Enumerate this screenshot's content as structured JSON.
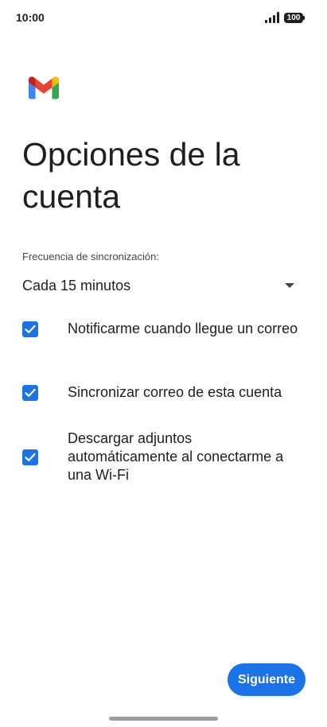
{
  "status_bar": {
    "time": "10:00",
    "battery": "100"
  },
  "page": {
    "title": "Opciones de la cuenta"
  },
  "sync": {
    "label": "Frecuencia de sincronización:",
    "selected": "Cada 15 minutos"
  },
  "options": [
    {
      "label": "Notificarme cuando llegue un correo",
      "checked": true
    },
    {
      "label": "Sincronizar correo de esta cuenta",
      "checked": true
    },
    {
      "label": "Descargar adjuntos automáticamente al conectarme a una Wi-Fi",
      "checked": true
    }
  ],
  "actions": {
    "next_label": "Siguiente"
  },
  "colors": {
    "accent": "#1a73e8",
    "text": "#1f1f1f",
    "secondary_text": "#444746"
  },
  "icons": [
    "gmail-logo",
    "signal-icon",
    "battery-icon",
    "dropdown-caret-icon",
    "checkbox-checked-icon"
  ]
}
